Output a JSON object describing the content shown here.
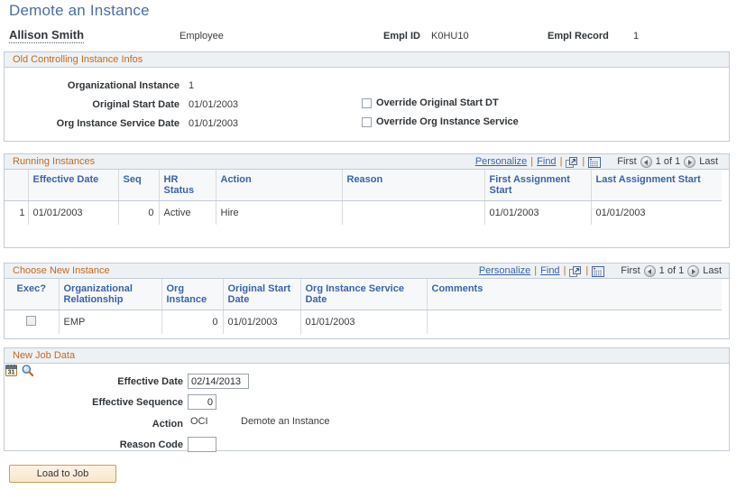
{
  "page": {
    "title": "Demote an Instance"
  },
  "identity": {
    "name": "Allison Smith",
    "role": "Employee",
    "empl_id_label": "Empl ID",
    "empl_id_value": "K0HU10",
    "empl_record_label": "Empl Record",
    "empl_record_value": "1"
  },
  "old_instance": {
    "header": "Old Controlling Instance Infos",
    "fields": [
      {
        "label": "Organizational Instance",
        "value": "1"
      },
      {
        "label": "Original Start Date",
        "value": "01/01/2003"
      },
      {
        "label": "Org Instance Service Date",
        "value": "01/01/2003"
      }
    ],
    "checkboxes": [
      {
        "label": "Override Original Start DT",
        "checked": false
      },
      {
        "label": "Override Org Instance Service",
        "checked": false
      }
    ]
  },
  "toolbar": {
    "personalize": "Personalize",
    "find": "Find",
    "sep": "|",
    "export_icon": "export-to-excel-icon",
    "grid_icon": "view-grid-icon",
    "first": "First",
    "last": "Last",
    "page_indicator": "1 of 1"
  },
  "running_instances": {
    "header": "Running Instances",
    "columns": [
      "Effective Date",
      "Seq",
      "HR Status",
      "Action",
      "Reason",
      "First Assignment Start",
      "Last Assignment Start"
    ],
    "rows": [
      {
        "num": "1",
        "effective_date": "01/01/2003",
        "seq": "0",
        "hr_status": "Active",
        "action": "Hire",
        "reason": "",
        "first_assignment_start": "01/01/2003",
        "last_assignment_start": "01/01/2003"
      }
    ]
  },
  "choose_new_instance": {
    "header": "Choose New Instance",
    "columns": [
      "Exec?",
      "Organizational Relationship",
      "Org Instance",
      "Original Start Date",
      "Org Instance Service Date",
      "Comments"
    ],
    "rows": [
      {
        "exec_checked": false,
        "organizational_relationship": "EMP",
        "org_instance": "0",
        "original_start_date": "01/01/2003",
        "org_instance_service_date": "01/01/2003",
        "comments": ""
      }
    ]
  },
  "new_job_data": {
    "header": "New Job Data",
    "effective_date_label": "Effective Date",
    "effective_date_value": "02/14/2013",
    "calendar_icon": "calendar-icon",
    "effective_sequence_label": "Effective Sequence",
    "effective_sequence_value": "0",
    "action_label": "Action",
    "action_code": "OCI",
    "action_description": "Demote an Instance",
    "reason_code_label": "Reason Code",
    "reason_code_value": "",
    "lookup_icon": "lookup-magnifier-icon"
  },
  "footer": {
    "load_button": "Load to Job"
  },
  "colors": {
    "title": "#4a6fa5",
    "section_header_text": "#c26a1e",
    "section_header_bg": "#eef1f4",
    "column_header_text": "#3a64a8",
    "link": "#3a64a8",
    "button_border": "#d49a52"
  }
}
